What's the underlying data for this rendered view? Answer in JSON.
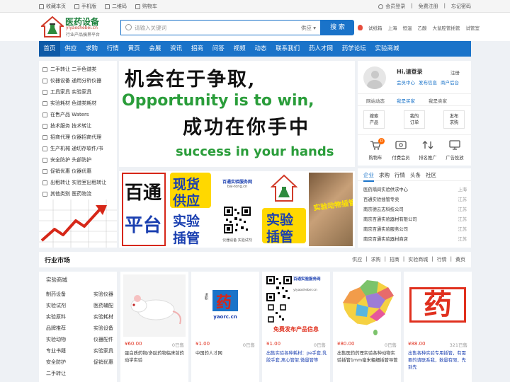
{
  "topbar": {
    "left": [
      "收藏本页",
      "手机版",
      "二维码",
      "购物车"
    ],
    "right": [
      "会员登录",
      "免费注册",
      "忘记密码"
    ]
  },
  "logo": {
    "name": "医药设备",
    "domain": "yiyaoshebei.cn",
    "slogan": "行业产品搞界平台"
  },
  "search": {
    "placeholder": "请输入关键词",
    "category": "供应",
    "button": "搜 索"
  },
  "hot_keywords": [
    "试纸箱",
    "上海",
    "恒温",
    "乙酸",
    "大鼠腔管插管",
    "试管室"
  ],
  "nav": [
    "首页",
    "供应",
    "求购",
    "行情",
    "黄页",
    "会展",
    "资讯",
    "招商",
    "问答",
    "视频",
    "动态",
    "联系我们",
    "药人才网",
    "药学论坛",
    "实验商城"
  ],
  "categories": [
    "二手转让 二手色谱类",
    "仪器设备 通用分析仪器",
    "工具家具 实验家具",
    "实验耗材 色谱类耗材",
    "在售产品 Waters",
    "技术服务 技术转让",
    "招商代理 仪器招商代理",
    "生产机械 通切存软件/书",
    "安全防护 头部防护",
    "促销优惠 仪器优惠",
    "出租转让 实验室出租转让",
    "其他类别 医药物流"
  ],
  "banner": {
    "line1": "机会在于争取,",
    "line2": "Opportunity is to win,",
    "line3": "成功在你手中",
    "line4": "success in your hands"
  },
  "ads": {
    "a1": [
      "百通",
      "平台"
    ],
    "a2": [
      "现货",
      "供应",
      "实验",
      "插管"
    ],
    "a3": {
      "title": "百通实验服务网",
      "sub": "bai-tong.cn",
      "bottom": "仪器设备 实验试剂"
    },
    "a4": [
      "实验",
      "插管"
    ],
    "a5": "实验动物插管"
  },
  "user": {
    "greeting": "Hi,请登录",
    "register": "注册",
    "links": [
      "会员中心",
      "发布信息",
      "商户后台"
    ],
    "tabs": [
      "网站动态",
      "我是买家",
      "我是卖家"
    ],
    "actions": [
      "搜索\n产品",
      "我的\n订单",
      "发布\n求购"
    ],
    "icons": [
      "购物车",
      "付费会员",
      "排名推广",
      "广告投放"
    ],
    "cart_count": "0"
  },
  "news": {
    "tabs": [
      "企业",
      "求购",
      "行情",
      "头条",
      "社区"
    ],
    "items": [
      {
        "name": "医药隔间实验供求中心",
        "loc": "上海"
      },
      {
        "name": "百通实验插管专卖",
        "loc": "江苏"
      },
      {
        "name": "南京德云志科技公司",
        "loc": "江苏"
      },
      {
        "name": "南京百通实验器材有限公司",
        "loc": "江苏"
      },
      {
        "name": "南京百通实验服务公司",
        "loc": "江苏"
      },
      {
        "name": "南京百通实验器材商店",
        "loc": "江苏"
      }
    ]
  },
  "market": {
    "title": "行业市场",
    "links": [
      "供应",
      "求购",
      "招商",
      "实验商城",
      "行情",
      "黄页"
    ],
    "sidebar_title": "实验商城",
    "sidebar": [
      [
        "制药设备",
        "实验仪器"
      ],
      [
        "实验试剂",
        "医药辅配"
      ],
      [
        "实验原料",
        "实验耗材"
      ],
      [
        "品牌推荐",
        "实验设备"
      ],
      [
        "实验动物",
        "仪器配件"
      ],
      [
        "专业书籍",
        "实验家具"
      ],
      [
        "安全防护",
        "促销优惠"
      ],
      [
        "二手转让",
        ""
      ]
    ],
    "products": [
      {
        "price": "¥60.00",
        "sold": "0已售",
        "title": "蛋白质药物/多肽药物临床前药动学实验"
      },
      {
        "price": "¥1.00",
        "sold": "0已售",
        "title": "中国药人才网"
      },
      {
        "price": "¥1.00",
        "sold": "0已售",
        "title": "出售实验各种耗材：pe手套,乳胶手套,离心管架,微量管等"
      },
      {
        "price": "¥80.00",
        "sold": "0已售",
        "title": "出售医药药理实验各种动物实验插管1mm毫米粗细插管导管"
      },
      {
        "price": "¥88.00",
        "sold": "321已售",
        "title": "出售各种实验专用插管，有需要的请联系我，数量有限，先到先"
      }
    ],
    "p2": {
      "cn": "药",
      "domain": "yaorc.cn",
      "top": "求职"
    },
    "p3": {
      "title": "百通实验服务网",
      "sub": "yiyaoshebei.cn",
      "cta": "免费发布产品信息"
    },
    "p5": "药"
  }
}
